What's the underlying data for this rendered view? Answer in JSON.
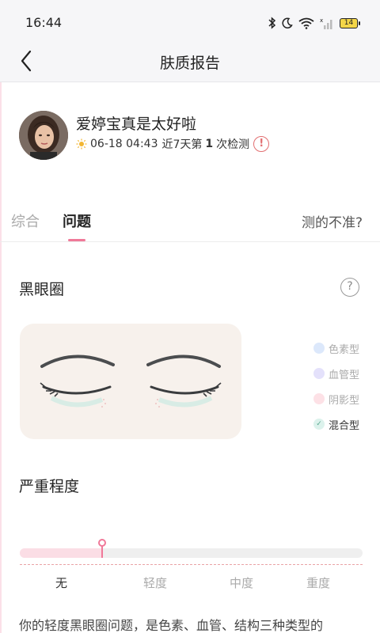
{
  "status_bar": {
    "time": "16:44",
    "battery": "14",
    "icons": [
      "bluetooth-icon",
      "moon-icon",
      "wifi-icon",
      "signal-icon",
      "battery-icon"
    ]
  },
  "nav": {
    "title": "肤质报告",
    "back_icon": "chevron-left-icon"
  },
  "user": {
    "name": "爱婷宝真是太好啦",
    "date": "06-18 04:43",
    "period_prefix": "近7天第",
    "count": "1",
    "period_suffix": "次检测",
    "warning_symbol": "!"
  },
  "tabs": {
    "items": [
      {
        "label": "综合",
        "active": false
      },
      {
        "label": "问题",
        "active": true
      }
    ],
    "link": "测的不准?"
  },
  "section": {
    "title": "黑眼圈",
    "help_symbol": "?"
  },
  "legend": [
    {
      "label": "色素型",
      "color": "#dce8fb",
      "checked": false
    },
    {
      "label": "血管型",
      "color": "#e4e1fb",
      "checked": false
    },
    {
      "label": "阴影型",
      "color": "#fde1e6",
      "checked": false
    },
    {
      "label": "混合型",
      "color": "#dcf2ec",
      "checked": true
    }
  ],
  "severity": {
    "title": "严重程度",
    "levels": [
      "无",
      "轻度",
      "中度",
      "重度"
    ],
    "level_fraction": 0.24
  },
  "description": "你的轻度黑眼圈问题，是色素、血管、结构三种类型的",
  "colors": {
    "accent": "#f07999",
    "warning": "#e26f71",
    "card_bg": "#f7f1ec"
  }
}
